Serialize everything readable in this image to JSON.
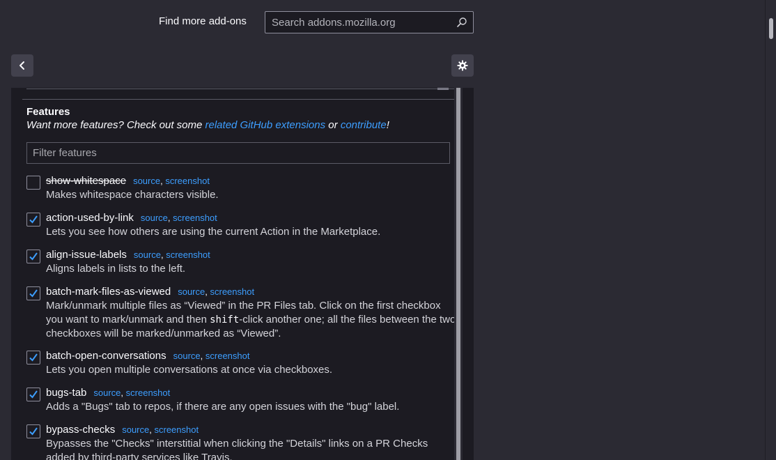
{
  "header": {
    "find_label": "Find more add-ons",
    "search_placeholder": "Search addons.mozilla.org"
  },
  "features_section": {
    "title": "Features",
    "subtitle_prefix": "Want more features? Check out some ",
    "subtitle_link1": "related GitHub extensions",
    "subtitle_mid": " or ",
    "subtitle_link2": "contribute",
    "subtitle_suffix": "!",
    "filter_placeholder": "Filter features"
  },
  "link_labels": {
    "source": "source",
    "screenshot": "screenshot",
    "separator": ","
  },
  "features": [
    {
      "name": "show-whitespace",
      "checked": false,
      "disabled": true,
      "desc": "Makes whitespace characters visible."
    },
    {
      "name": "action-used-by-link",
      "checked": true,
      "desc": "Lets you see how others are using the current Action in the Marketplace."
    },
    {
      "name": "align-issue-labels",
      "checked": true,
      "desc": "Aligns labels in lists to the left."
    },
    {
      "name": "batch-mark-files-as-viewed",
      "checked": true,
      "desc_before": "Mark/unmark multiple files as “Viewed” in the PR Files tab. Click on the first checkbox you want to mark/unmark and then ",
      "desc_code": "shift",
      "desc_after": "-click another one; all the files between the two checkboxes will be marked/unmarked as “Viewed”."
    },
    {
      "name": "batch-open-conversations",
      "checked": true,
      "desc": "Lets you open multiple conversations at once via checkboxes."
    },
    {
      "name": "bugs-tab",
      "checked": true,
      "desc": "Adds a \"Bugs\" tab to repos, if there are any open issues with the \"bug\" label."
    },
    {
      "name": "bypass-checks",
      "checked": true,
      "desc": "Bypasses the \"Checks\" interstitial when clicking the \"Details\" links on a PR Checks added by third-party services like Travis."
    }
  ],
  "colors": {
    "link": "#3d9eff",
    "check": "#3d9eff",
    "background": "#2b2a33",
    "panel": "#1c1b22"
  },
  "icons": {
    "search": "search-icon",
    "back": "chevron-left-icon",
    "settings": "gear-icon",
    "check": "checkmark-icon"
  }
}
